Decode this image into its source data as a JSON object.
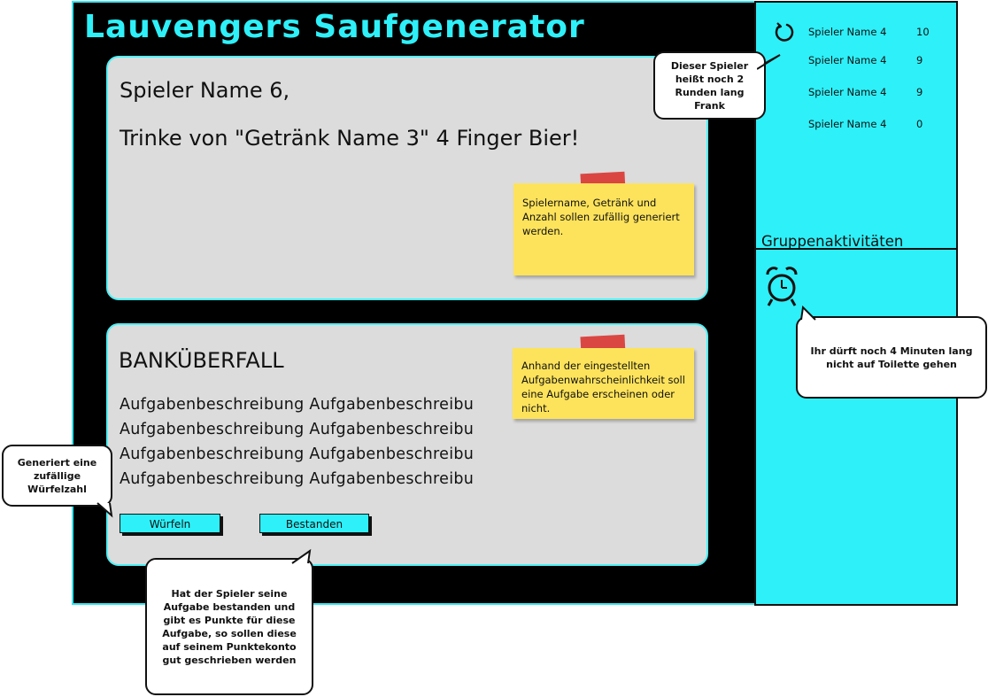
{
  "app": {
    "title": "Lauvengers Saufgenerator"
  },
  "drink_card": {
    "player_line": "Spieler Name 6,",
    "instruction": "Trinke von \"Getränk Name 3\" 4 Finger Bier!",
    "note": "Spielername, Getränk und Anzahl sollen zufällig generiert werden."
  },
  "task_card": {
    "title": "BANKÜBERFALL",
    "description_lines": [
      "Aufgabenbeschreibung Aufgabenbeschreibung",
      "Aufgabenbeschreibung Aufgabenbeschreibung",
      "Aufgabenbeschreibung Aufgabenbeschreibung",
      "Aufgabenbeschreibung Aufgabenbeschreibung"
    ],
    "note": "Anhand der eingestellten Aufgabenwahrscheinlichkeit soll eine Aufgabe erscheinen oder nicht.",
    "buttons": {
      "roll": "Würfeln",
      "passed": "Bestanden"
    }
  },
  "scoreboard": {
    "rows": [
      {
        "name": "Spieler Name 4",
        "points": "10"
      },
      {
        "name": "Spieler Name 4",
        "points": "9"
      },
      {
        "name": "Spieler Name 4",
        "points": "9"
      },
      {
        "name": "Spieler Name 4",
        "points": "0"
      }
    ]
  },
  "group_activities": {
    "heading": "Gruppenaktivitäten"
  },
  "callouts": {
    "spieler": "Dieser Spieler heißt noch 2 Runden lang Frank",
    "toilette": "Ihr dürft noch 4 Minuten lang nicht auf Toilette gehen",
    "wuerfel": "Generiert eine zufällige Würfelzahl",
    "bestanden": "Hat der Spieler seine Aufgabe bestanden und gibt es Punkte für diese Aufgabe, so sollen diese auf seinem Punktekonto gut geschrieben werden"
  },
  "icons": {
    "refresh": "refresh-icon",
    "alarm": "alarm-clock-icon"
  },
  "colors": {
    "accent": "#2ef0f8",
    "background": "#000000",
    "card": "#dcdcdc",
    "sticky": "#fde35b",
    "tape": "#d93a35"
  }
}
